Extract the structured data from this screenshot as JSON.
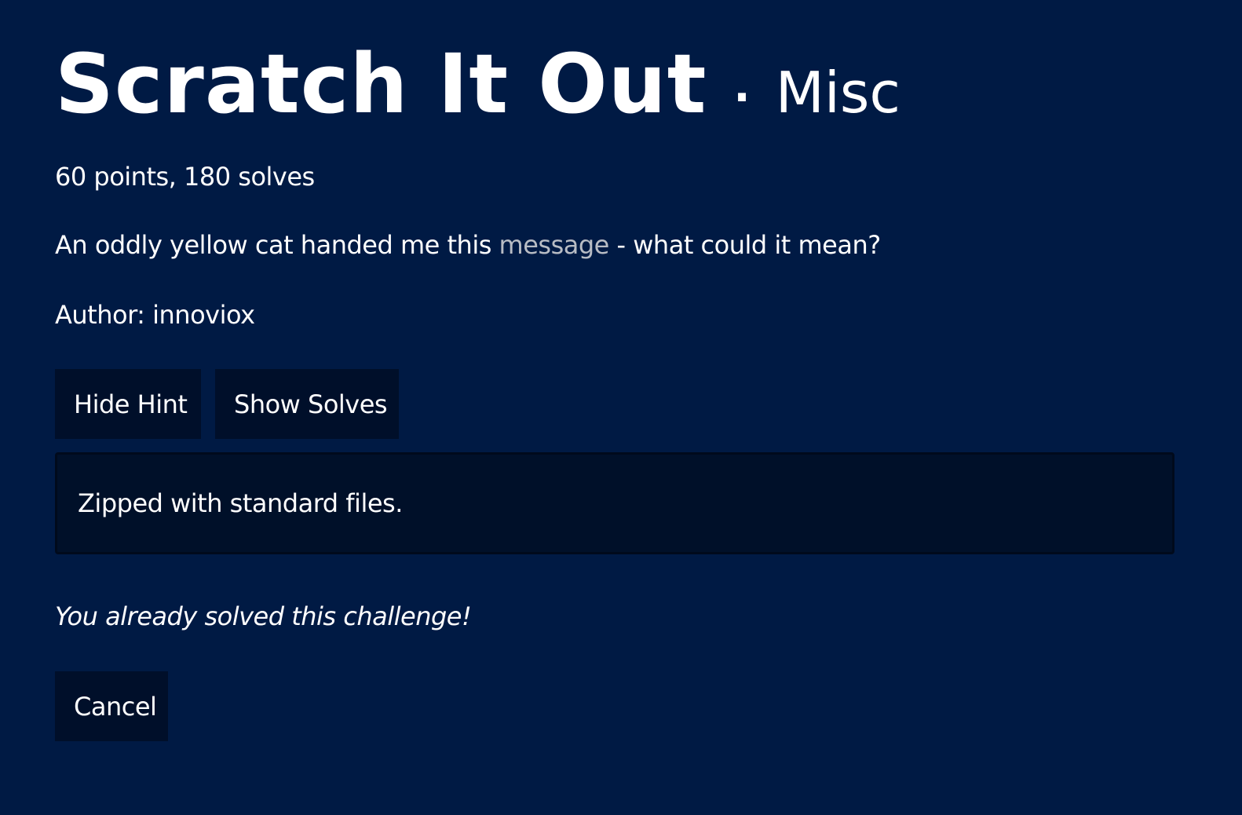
{
  "challenge": {
    "title": "Scratch It Out",
    "separator": "·",
    "category": "Misc",
    "meta": "60 points, 180 solves",
    "description_before": "An oddly yellow cat handed me this ",
    "description_link": "message",
    "description_after": " - what could it mean?",
    "author": "Author: innoviox"
  },
  "buttons": {
    "hide_hint": "Hide Hint",
    "show_solves": "Show Solves",
    "cancel": "Cancel"
  },
  "hint": {
    "text": "Zipped with standard files."
  },
  "status": {
    "solved_message": "You already solved this challenge!"
  },
  "colors": {
    "background": "#001a44",
    "button_bg": "#000f2a",
    "hint_bg": "#001029",
    "link": "#b8bcc4",
    "text": "#ffffff"
  }
}
